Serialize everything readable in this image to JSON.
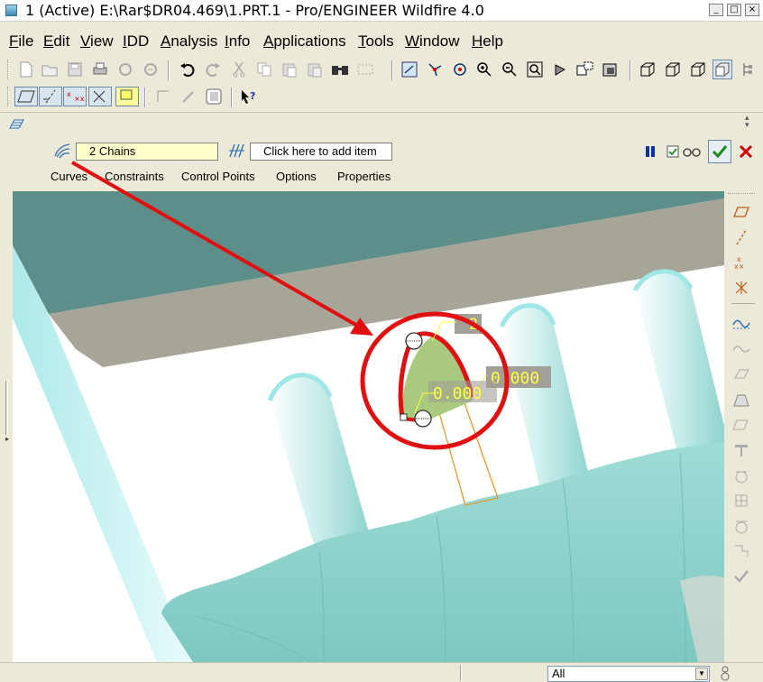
{
  "window": {
    "title": "1 (Active) E:\\Rar$DR04.469\\1.PRT.1 - Pro/ENGINEER Wildfire 4.0",
    "buttons": {
      "minimize": "_",
      "maximize": "□",
      "close": "×"
    }
  },
  "menu": {
    "items": [
      "File",
      "Edit",
      "View",
      "IDD",
      "Analysis",
      "Info",
      "Applications",
      "Tools",
      "Window",
      "Help"
    ]
  },
  "dashboard": {
    "chains_value": "2 Chains",
    "add_item_placeholder": "Click here to add item",
    "tabs": [
      "Curves",
      "Constraints",
      "Control Points",
      "Options",
      "Properties"
    ]
  },
  "viewport": {
    "dim_label_1": "2",
    "dim_label_2": "0.000",
    "dim_label_3": "0.000"
  },
  "statusbar": {
    "filter_value": "All"
  },
  "colors": {
    "accent_red": "#e01010",
    "surface_cyan": "#a8e0dc",
    "pause_blue": "#0033aa",
    "ok_green": "#1f8a1f"
  }
}
